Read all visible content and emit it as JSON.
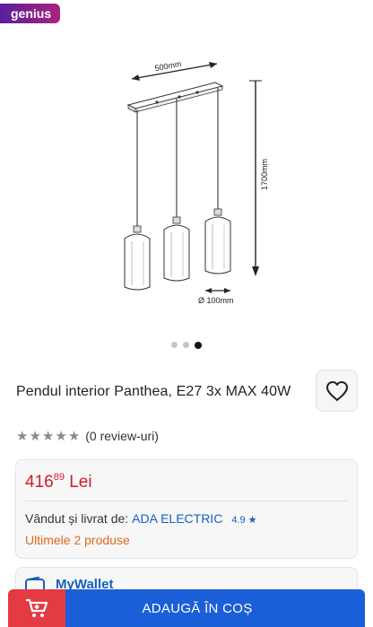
{
  "brand_badge": "genius",
  "gallery": {
    "dimension_width": "500mm",
    "dimension_height": "1700mm",
    "dimension_diameter": "Ø 100mm",
    "slide_count": 3,
    "active_slide": 3
  },
  "product": {
    "title": "Pendul interior Panthea, E27 3x MAX 40W",
    "rating_stars": 0,
    "reviews_text": "(0 review-uri)"
  },
  "offer": {
    "price_int": "416",
    "price_dec": "89",
    "currency": "Lei",
    "seller_prefix": "Vândut și livrat de:",
    "seller_name": "ADA ELECTRIC",
    "seller_rating": "4.9",
    "stock_text": "Ultimele 2 produse"
  },
  "wallet": {
    "label": "MyWallet"
  },
  "cart_button": {
    "label": "ADAUGĂ ÎN COȘ"
  },
  "colors": {
    "price": "#d01c2a",
    "link": "#1560bd",
    "stock": "#e06a1e",
    "cart_bg": "#1a5fd8",
    "cart_icon_bg": "#e33a44",
    "badge_from": "#5a1f9a",
    "badge_to": "#a8237f"
  }
}
